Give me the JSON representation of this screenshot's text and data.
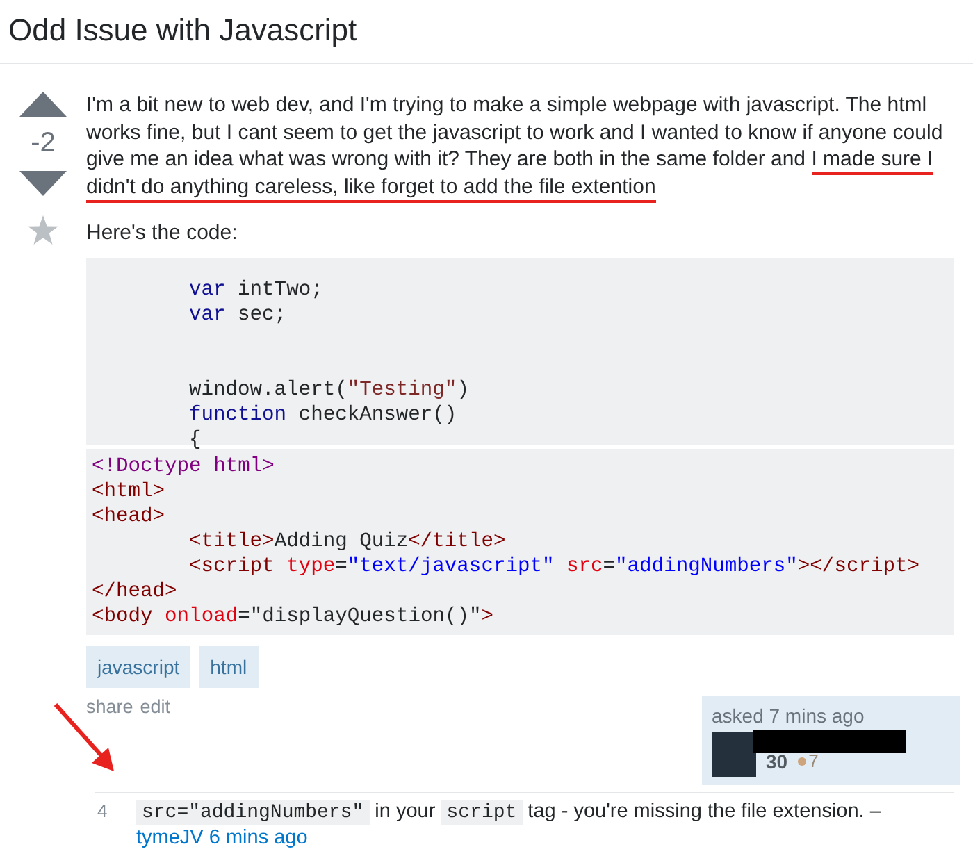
{
  "question": {
    "title": "Odd Issue with Javascript",
    "votes": {
      "score": "-2"
    },
    "paragraph": [
      {
        "text": "I'm a bit new to web dev, and I'm trying to make a simple webpage with javascript. The html works fine, but I cant seem to get the javascript to work and I wanted to know if anyone could give me an idea what was wrong with it? They are both in the same folder and ",
        "underlined": false
      },
      {
        "text": "I made sure I didn't do anything careless, like forget to add the file extention",
        "underlined": true
      }
    ],
    "intro": "Here's the code:",
    "code_blocks": [
      {
        "groups": [
          [
            {
              "indented": true,
              "tokens": [
                {
                  "text": "var",
                  "kind": "keyword"
                },
                {
                  "text": " intTwo;",
                  "kind": "plain"
                }
              ]
            },
            {
              "indented": true,
              "tokens": [
                {
                  "text": "var",
                  "kind": "keyword"
                },
                {
                  "text": " sec;",
                  "kind": "plain"
                }
              ]
            }
          ],
          [
            {
              "indented": true,
              "tokens": [
                {
                  "text": "window.alert(",
                  "kind": "plain"
                },
                {
                  "text": "\"Testing\"",
                  "kind": "jsstring"
                },
                {
                  "text": ")",
                  "kind": "plain"
                }
              ]
            },
            {
              "indented": true,
              "tokens": [
                {
                  "text": "function",
                  "kind": "keyword"
                },
                {
                  "text": " checkAnswer()",
                  "kind": "plain"
                }
              ]
            },
            {
              "indented": true,
              "tokens": [
                {
                  "text": "{",
                  "kind": "plain"
                }
              ]
            }
          ]
        ]
      },
      {
        "groups": [
          [
            {
              "indented": false,
              "tokens": [
                {
                  "text": "<!Doctype html>",
                  "kind": "doctype"
                }
              ]
            },
            {
              "indented": false,
              "tokens": [
                {
                  "text": "<html>",
                  "kind": "tag"
                }
              ]
            },
            {
              "indented": false,
              "tokens": [
                {
                  "text": "<head>",
                  "kind": "tag"
                }
              ]
            },
            {
              "indented": true,
              "tokens": [
                {
                  "text": "<title>",
                  "kind": "tag"
                },
                {
                  "text": "Adding Quiz",
                  "kind": "plain"
                },
                {
                  "text": "</title>",
                  "kind": "tag"
                }
              ]
            },
            {
              "indented": true,
              "tokens": [
                {
                  "text": "<script ",
                  "kind": "tag"
                },
                {
                  "text": "type",
                  "kind": "attr"
                },
                {
                  "text": "=",
                  "kind": "plain"
                },
                {
                  "text": "\"text/javascript\"",
                  "kind": "value"
                },
                {
                  "text": " src",
                  "kind": "attr"
                },
                {
                  "text": "=",
                  "kind": "plain"
                },
                {
                  "text": "\"addingNumbers\"",
                  "kind": "value"
                },
                {
                  "text": "></script>",
                  "kind": "tag"
                }
              ]
            },
            {
              "indented": false,
              "tokens": [
                {
                  "text": "</head>",
                  "kind": "tag"
                }
              ]
            },
            {
              "indented": false,
              "tokens": [
                {
                  "text": "<body ",
                  "kind": "tag"
                },
                {
                  "text": "onload",
                  "kind": "attr"
                },
                {
                  "text": "=\"displayQuestion()\"",
                  "kind": "plain"
                },
                {
                  "text": ">",
                  "kind": "tag"
                }
              ]
            }
          ]
        ]
      }
    ],
    "tags": [
      "javascript",
      "html"
    ],
    "actions": [
      "share",
      "edit"
    ],
    "asked": {
      "time": "asked 7 mins ago",
      "reputation": "30",
      "bronze": "7"
    }
  },
  "comments": [
    {
      "score": "4",
      "parts": [
        {
          "text": "src=\"addingNumbers\"",
          "kind": "code"
        },
        {
          "text": " in your ",
          "kind": "text"
        },
        {
          "text": "script",
          "kind": "code"
        },
        {
          "text": " tag - you're missing the file extension. – ",
          "kind": "text"
        }
      ],
      "user": "tymeJV",
      "time": "6 mins ago"
    }
  ]
}
